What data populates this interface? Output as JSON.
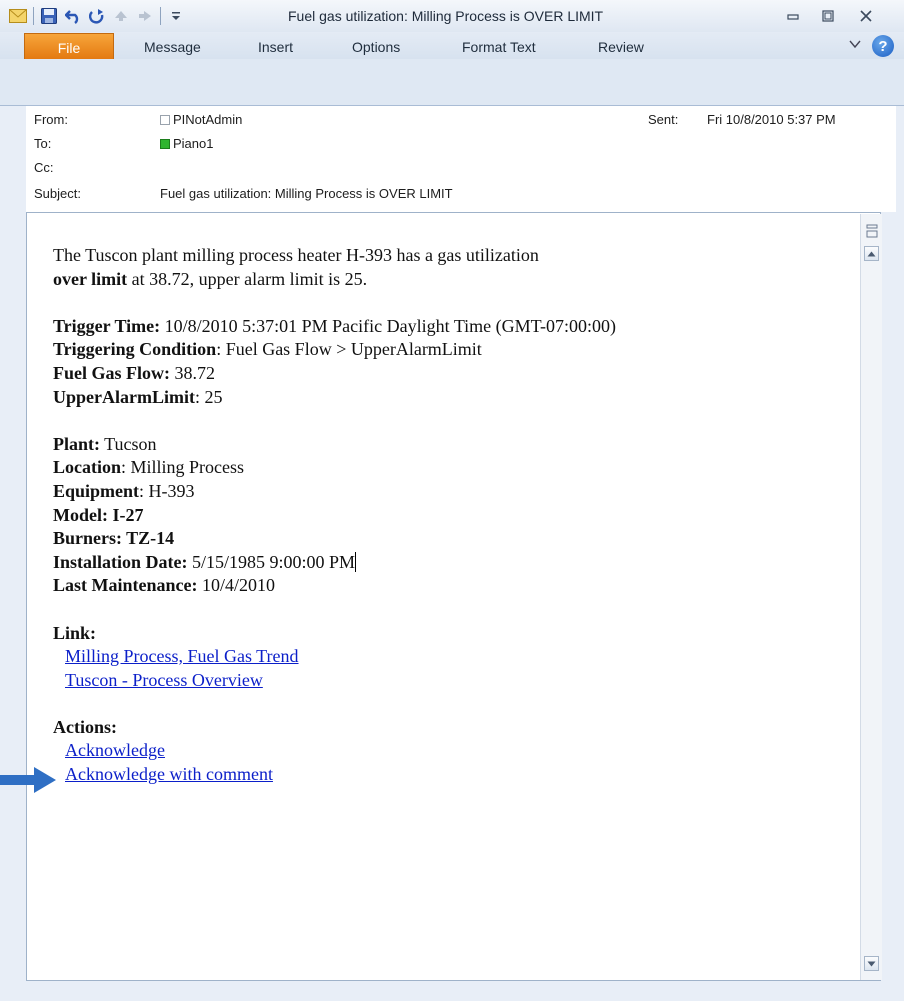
{
  "window": {
    "title": "Fuel gas utilization: Milling Process is OVER LIMIT",
    "qat_icons": [
      "mail-icon",
      "save-icon",
      "undo-icon",
      "redo-icon",
      "up-arrow-icon",
      "down-arrow-icon",
      "customize-icon"
    ],
    "controls": {
      "minimize": "▭",
      "maximize": "▢",
      "close": "✕"
    }
  },
  "ribbon": {
    "file_tab": "File",
    "tabs": [
      "Message",
      "Insert",
      "Options",
      "Format Text",
      "Review"
    ],
    "help_icon_text": "?",
    "collapse_icon": "♡"
  },
  "header": {
    "from_label": "From:",
    "from_value": "PINotAdmin",
    "to_label": "To:",
    "to_value": "Piano1",
    "cc_label": "Cc:",
    "cc_value": "",
    "subject_label": "Subject:",
    "subject_value": "Fuel gas utilization: Milling Process is OVER LIMIT",
    "sent_label": "Sent:",
    "sent_value": "Fri 10/8/2010 5:37 PM"
  },
  "body": {
    "intro_line1": "The Tuscon plant milling process heater H-393 has a gas utilization",
    "intro_over_limit": "over limit",
    "intro_line2_rest": " at 38.72, upper alarm limit is 25.",
    "trigger_time_label": "Trigger Time:",
    "trigger_time_value": " 10/8/2010 5:37:01 PM Pacific Daylight Time (GMT-07:00:00)",
    "triggering_condition_label": "Triggering Condition",
    "triggering_condition_value": ": Fuel Gas Flow > UpperAlarmLimit",
    "fuel_gas_flow_label": "Fuel Gas Flow:",
    "fuel_gas_flow_value": " 38.72",
    "upper_alarm_limit_label": "UpperAlarmLimit",
    "upper_alarm_limit_value": ": 25",
    "plant_label": "Plant:",
    "plant_value": " Tucson",
    "location_label": "Location",
    "location_value": ": Milling Process",
    "equipment_label": "Equipment",
    "equipment_value": ": H-393",
    "model_label": "Model:",
    "model_value": " I-27",
    "burners_label": "Burners:",
    "burners_value": " TZ-14",
    "installation_date_label": "Installation Date:",
    "installation_date_value": " 5/15/1985 9:00:00 PM",
    "last_maintenance_label": "Last Maintenance:",
    "last_maintenance_value": " 10/4/2010",
    "link_heading": "Link:",
    "links": [
      "Milling Process, Fuel Gas Trend",
      "Tuscon - Process Overview"
    ],
    "actions_heading": "Actions:",
    "actions": [
      "Acknowledge",
      "Acknowledge with comment"
    ]
  },
  "colors": {
    "file_tab": "#e2760e",
    "link": "#0b1fc9",
    "arrow": "#2f6fc4"
  }
}
